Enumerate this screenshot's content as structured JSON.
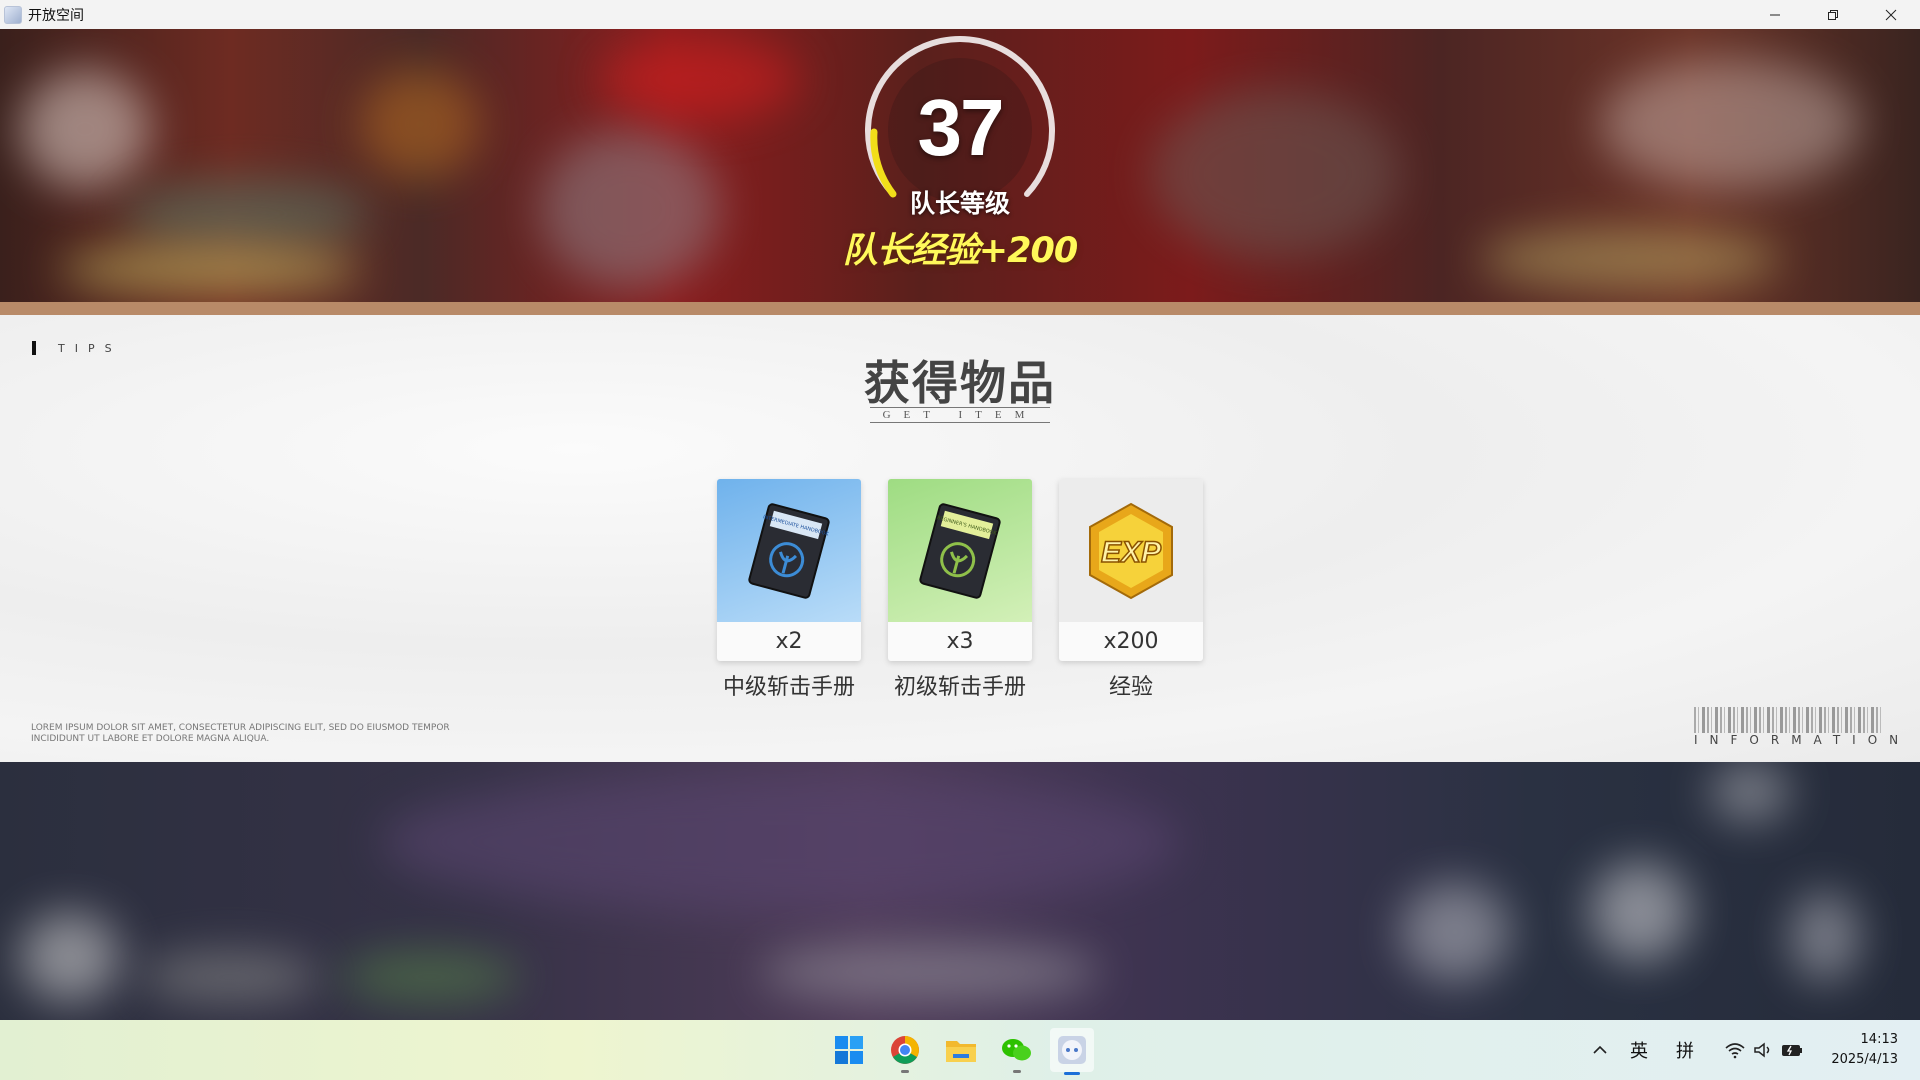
{
  "window": {
    "title": "开放空间"
  },
  "banner": {
    "level": "37",
    "level_label": "队长等级",
    "exp_gain": "队长经验+200"
  },
  "panel": {
    "tips_label": "TIPS",
    "heading": "获得物品",
    "subheading": "GET ITEM",
    "items": [
      {
        "qty": "x2",
        "name": "中级斩击手册",
        "icon": "intermediate-handbook-icon",
        "color": "#8fc7ef"
      },
      {
        "qty": "x3",
        "name": "初级斩击手册",
        "icon": "beginner-handbook-icon",
        "color": "#b9e69d"
      },
      {
        "qty": "x200",
        "name": "经验",
        "icon": "exp-icon",
        "color": "#ececec"
      }
    ],
    "lorem": "LOREM IPSUM DOLOR SIT AMET, CONSECTETUR ADIPISCING ELIT, SED DO EIUSMOD TEMPOR INCIDIDUNT UT LABORE ET DOLORE MAGNA ALIQUA.",
    "info_label": "INFORMATION",
    "handbook_covers": {
      "intermediate": "INTERMEDIATE HANDBOOK",
      "beginner": "BEGINNER'S HANDBOOK"
    },
    "exp_badge": "EXP"
  },
  "taskbar": {
    "tray": {
      "lang1": "英",
      "lang2": "拼"
    },
    "clock": {
      "time": "14:13",
      "date": "2025/4/13"
    }
  }
}
